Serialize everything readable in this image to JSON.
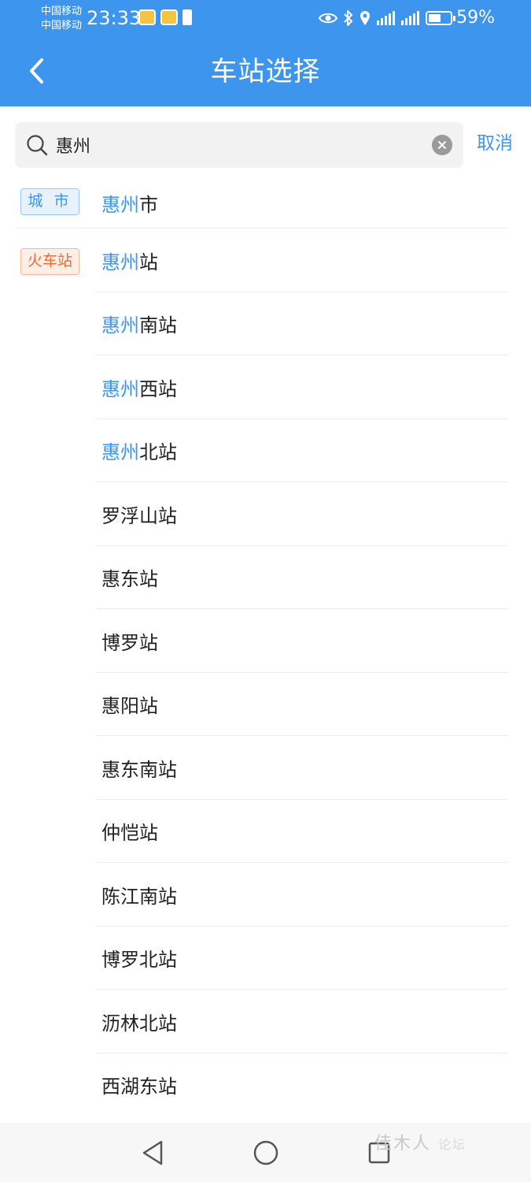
{
  "status": {
    "carrier1": "中国移动",
    "carrier2": "中国移动",
    "time": "23:33",
    "battery_text": "59%",
    "battery_level": 0.59
  },
  "header": {
    "title": "车站选择"
  },
  "search": {
    "query": "惠州",
    "cancel_label": "取消"
  },
  "tags": {
    "city": "城 市",
    "train": "火车站"
  },
  "city_result": {
    "highlight": "惠州",
    "rest": "市"
  },
  "stations": [
    {
      "highlight": "惠州",
      "rest": "站"
    },
    {
      "highlight": "惠州",
      "rest": "南站"
    },
    {
      "highlight": "惠州",
      "rest": "西站"
    },
    {
      "highlight": "惠州",
      "rest": "北站"
    },
    {
      "highlight": "",
      "rest": "罗浮山站"
    },
    {
      "highlight": "",
      "rest": "惠东站"
    },
    {
      "highlight": "",
      "rest": "博罗站"
    },
    {
      "highlight": "",
      "rest": "惠阳站"
    },
    {
      "highlight": "",
      "rest": "惠东南站"
    },
    {
      "highlight": "",
      "rest": "仲恺站"
    },
    {
      "highlight": "",
      "rest": "陈江南站"
    },
    {
      "highlight": "",
      "rest": "博罗北站"
    },
    {
      "highlight": "",
      "rest": "沥林北站"
    },
    {
      "highlight": "",
      "rest": "西湖东站"
    }
  ],
  "watermark": {
    "main": "佳木人",
    "sub": "论坛"
  },
  "colors": {
    "accent": "#3d95ee",
    "train_tag": "#f26a33"
  }
}
